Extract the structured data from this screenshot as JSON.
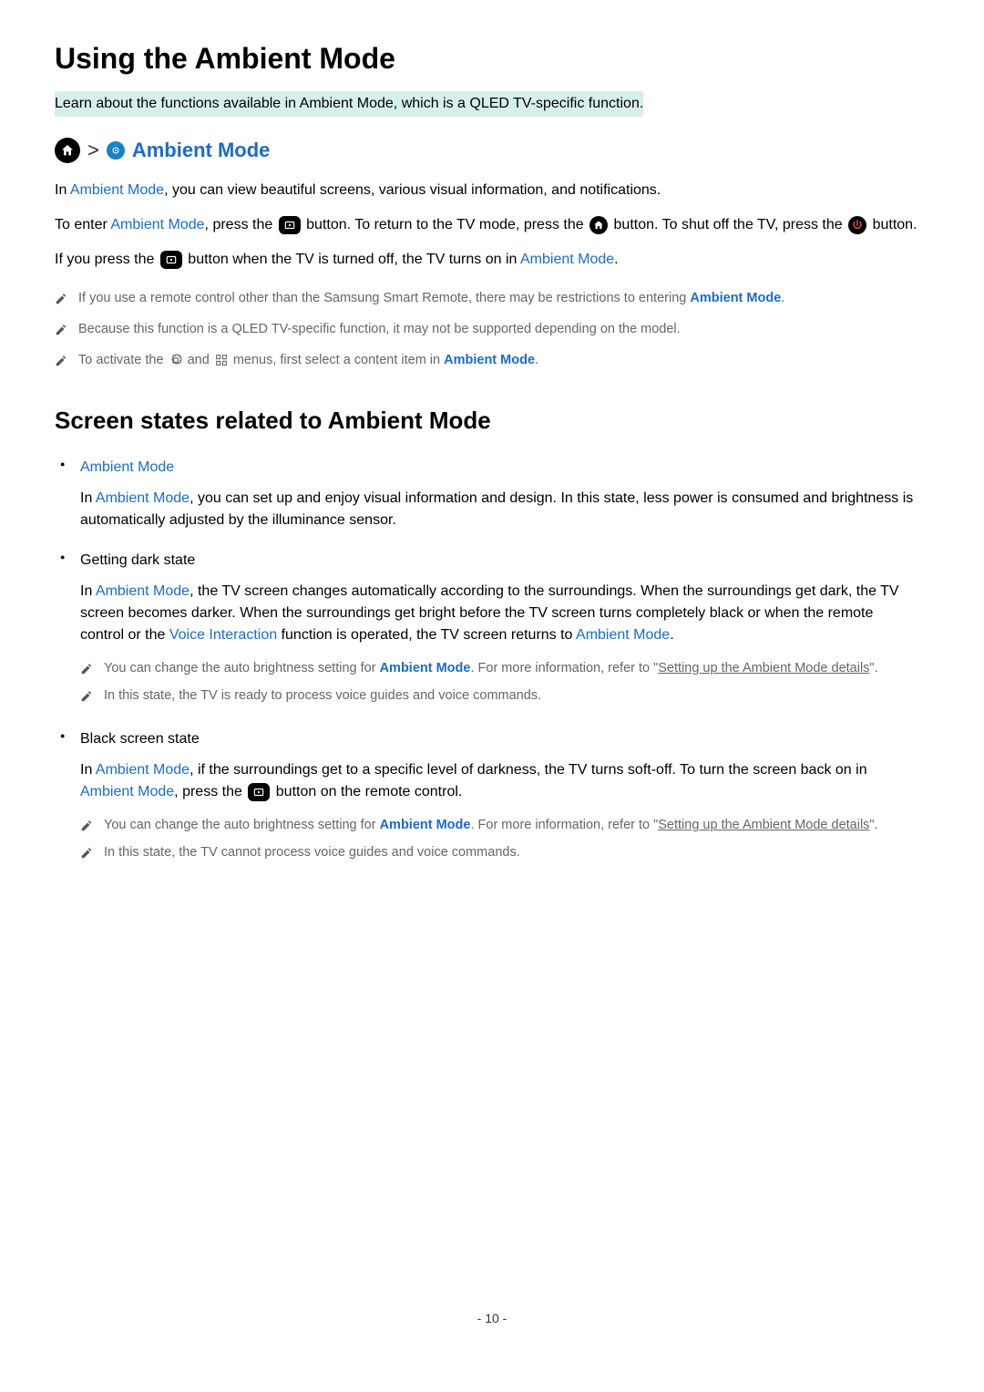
{
  "page": {
    "title": "Using the Ambient Mode",
    "intro": "Learn about the functions available in Ambient Mode, which is a QLED TV-specific function.",
    "number_prefix": "- ",
    "number": "10",
    "number_suffix": " -"
  },
  "breadcrumb": {
    "label": "Ambient Mode"
  },
  "p1": {
    "pre": "In ",
    "link": "Ambient Mode",
    "post": ", you can view beautiful screens, various visual information, and notifications."
  },
  "p2": {
    "t1": "To enter ",
    "link1": "Ambient Mode",
    "t2": ", press the ",
    "t3": " button. To return to the TV mode, press the ",
    "t4": " button. To shut off the TV, press the ",
    "t5": " button."
  },
  "p3": {
    "t1": "If you press the ",
    "t2": " button when the TV is turned off, the TV turns on in ",
    "link": "Ambient Mode",
    "t3": "."
  },
  "notes": [
    {
      "pre": "If you use a remote control other than the Samsung Smart Remote, there may be restrictions to entering ",
      "link": "Ambient Mode",
      "post": "."
    },
    {
      "pre": "Because this function is a QLED TV-specific function, it may not be supported depending on the model.",
      "link": "",
      "post": ""
    },
    {
      "pre": "To activate the ",
      "mid": " and ",
      "post_pre": " menus, first select a content item in ",
      "link": "Ambient Mode",
      "post": "."
    }
  ],
  "section2": {
    "title": "Screen states related to Ambient Mode"
  },
  "items": [
    {
      "title_link": "Ambient Mode",
      "body_pre": "In ",
      "body_link1": "Ambient Mode",
      "body_post": ", you can set up and enjoy visual information and design. In this state, less power is consumed and brightness is automatically adjusted by the illuminance sensor.",
      "notes": []
    },
    {
      "title_plain": "Getting dark state",
      "body_pre": "In ",
      "body_link1": "Ambient Mode",
      "body_mid1": ", the TV screen changes automatically according to the surroundings. When the surroundings get dark, the TV screen becomes darker. When the surroundings get bright before the TV screen turns completely black or when the remote control or the ",
      "body_link2": "Voice Interaction",
      "body_mid2": " function is operated, the TV screen returns to ",
      "body_link3": "Ambient Mode",
      "body_post": ".",
      "notes": [
        {
          "pre": "You can change the auto brightness setting for ",
          "link": "Ambient Mode",
          "mid": ". For more information, refer to \"",
          "ulink": "Setting up the Ambient Mode details",
          "post": "\"."
        },
        {
          "plain": "In this state, the TV is ready to process voice guides and voice commands."
        }
      ]
    },
    {
      "title_plain": "Black screen state",
      "body_pre": "In ",
      "body_link1": "Ambient Mode",
      "body_mid1": ", if the surroundings get to a specific level of darkness, the TV turns soft-off. To turn the screen back on in ",
      "body_link2": "Ambient Mode",
      "body_mid2": ", press the ",
      "body_post_after_icon": " button on the remote control.",
      "notes": [
        {
          "pre": "You can change the auto brightness setting for ",
          "link": "Ambient Mode",
          "mid": ". For more information, refer to \"",
          "ulink": "Setting up the Ambient Mode details",
          "post": "\"."
        },
        {
          "plain": "In this state, the TV cannot process voice guides and voice commands."
        }
      ]
    }
  ]
}
